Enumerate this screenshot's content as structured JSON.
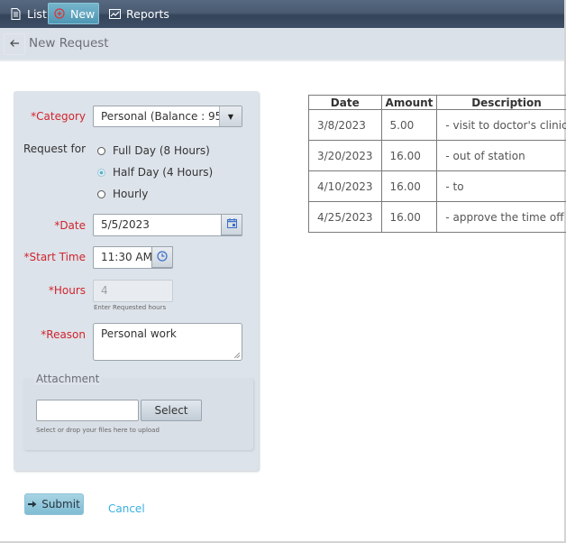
{
  "nav": {
    "items": [
      {
        "label": "List",
        "icon": "document-icon",
        "active": false
      },
      {
        "label": "New",
        "icon": "plus-circle-icon",
        "active": true
      },
      {
        "label": "Reports",
        "icon": "chart-icon",
        "active": false
      }
    ]
  },
  "header": {
    "back_icon": "arrow-left-icon",
    "title": "New Request"
  },
  "form": {
    "category": {
      "label": "*Category",
      "value": "Personal (Balance : 95 ...",
      "dropdown_icon": "caret-down-icon"
    },
    "request_for": {
      "label": "Request for",
      "options": [
        {
          "label": "Full Day (8 Hours)",
          "checked": false
        },
        {
          "label": "Half Day (4 Hours)",
          "checked": true
        },
        {
          "label": "Hourly",
          "checked": false
        }
      ]
    },
    "date": {
      "label": "*Date",
      "value": "5/5/2023",
      "icon": "calendar-icon"
    },
    "start_time": {
      "label": "*Start Time",
      "value": "11:30 AM",
      "icon": "clock-icon"
    },
    "hours": {
      "label": "*Hours",
      "value": "4",
      "hint": "Enter Requested hours"
    },
    "reason": {
      "label": "*Reason",
      "value": "Personal work"
    },
    "attachment": {
      "legend": "Attachment",
      "file_value": "",
      "select_label": "Select",
      "hint": "Select or drop your files here to upload"
    },
    "submit_label": "Submit",
    "cancel_label": "Cancel"
  },
  "history": {
    "columns": [
      "Date",
      "Amount",
      "Description"
    ],
    "rows": [
      {
        "date": "3/8/2023",
        "amount": "5.00",
        "description": "- visit to doctor's clinic"
      },
      {
        "date": "3/20/2023",
        "amount": "16.00",
        "description": "- out of station"
      },
      {
        "date": "4/10/2023",
        "amount": "16.00",
        "description": "- to"
      },
      {
        "date": "4/25/2023",
        "amount": "16.00",
        "description": "- approve the time off"
      }
    ]
  },
  "colors": {
    "required_label": "#d0242d",
    "link": "#3ab0e0",
    "active_nav": "#5ea4c0",
    "nav_bar": "#4a5b72"
  }
}
